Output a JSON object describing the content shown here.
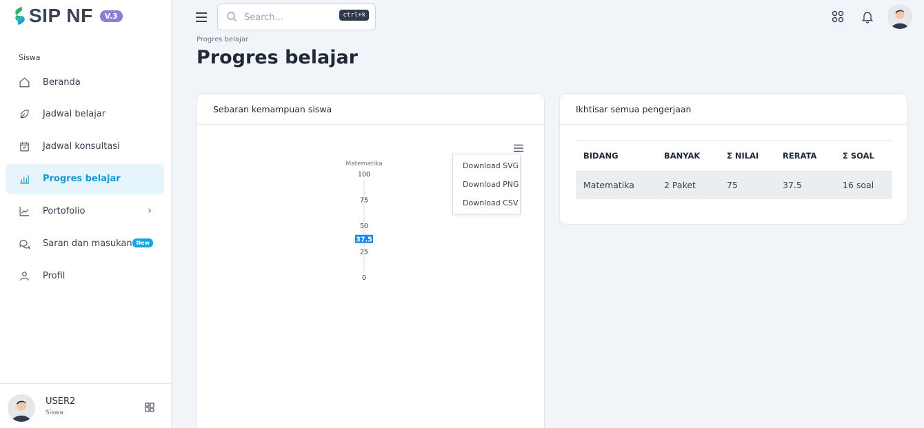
{
  "app": {
    "logo_text": "SIP NF",
    "version_badge": "V.3"
  },
  "sidebar": {
    "section_label": "Siswa",
    "items": [
      {
        "label": "Beranda",
        "icon": "home-icon"
      },
      {
        "label": "Jadwal belajar",
        "icon": "leaf-icon"
      },
      {
        "label": "Jadwal konsultasi",
        "icon": "calendar-check-icon"
      },
      {
        "label": "Progres belajar",
        "icon": "bar-chart-icon",
        "active": true
      },
      {
        "label": "Portofolio",
        "icon": "trending-up-icon",
        "chevron": "›"
      },
      {
        "label": "Saran dan masukan",
        "icon": "chat-icon",
        "badge": "New"
      },
      {
        "label": "Profil",
        "icon": "user-icon"
      }
    ],
    "footer": {
      "user_name": "USER2",
      "user_role": "Siswa"
    }
  },
  "topbar": {
    "search_placeholder": "Search...",
    "search_shortcut": "ctrl+k"
  },
  "page": {
    "breadcrumb": "Progres belajar",
    "title": "Progres belajar"
  },
  "left_card": {
    "title": "Sebaran kemampuan siswa",
    "menu": [
      "Download SVG",
      "Download PNG",
      "Download CSV"
    ]
  },
  "chart_data": {
    "type": "bar",
    "categories": [
      "Matematika"
    ],
    "series": [
      {
        "values": [
          37.5
        ]
      }
    ],
    "data_labels": [
      "37.5"
    ],
    "yticks": [
      "100",
      "75",
      "50",
      "25",
      "0"
    ],
    "ylim": [
      0,
      100
    ],
    "colors": {
      "label_bg": "#1e88e5",
      "axis": "#d9d9d9"
    }
  },
  "right_card": {
    "title": "Ikhtisar semua pengerjaan",
    "columns": [
      "BIDANG",
      "BANYAK",
      "Σ NILAI",
      "RERATA",
      "Σ SOAL"
    ],
    "rows": [
      [
        "Matematika",
        "2 Paket",
        "75",
        "37.5",
        "16 soal"
      ]
    ]
  }
}
